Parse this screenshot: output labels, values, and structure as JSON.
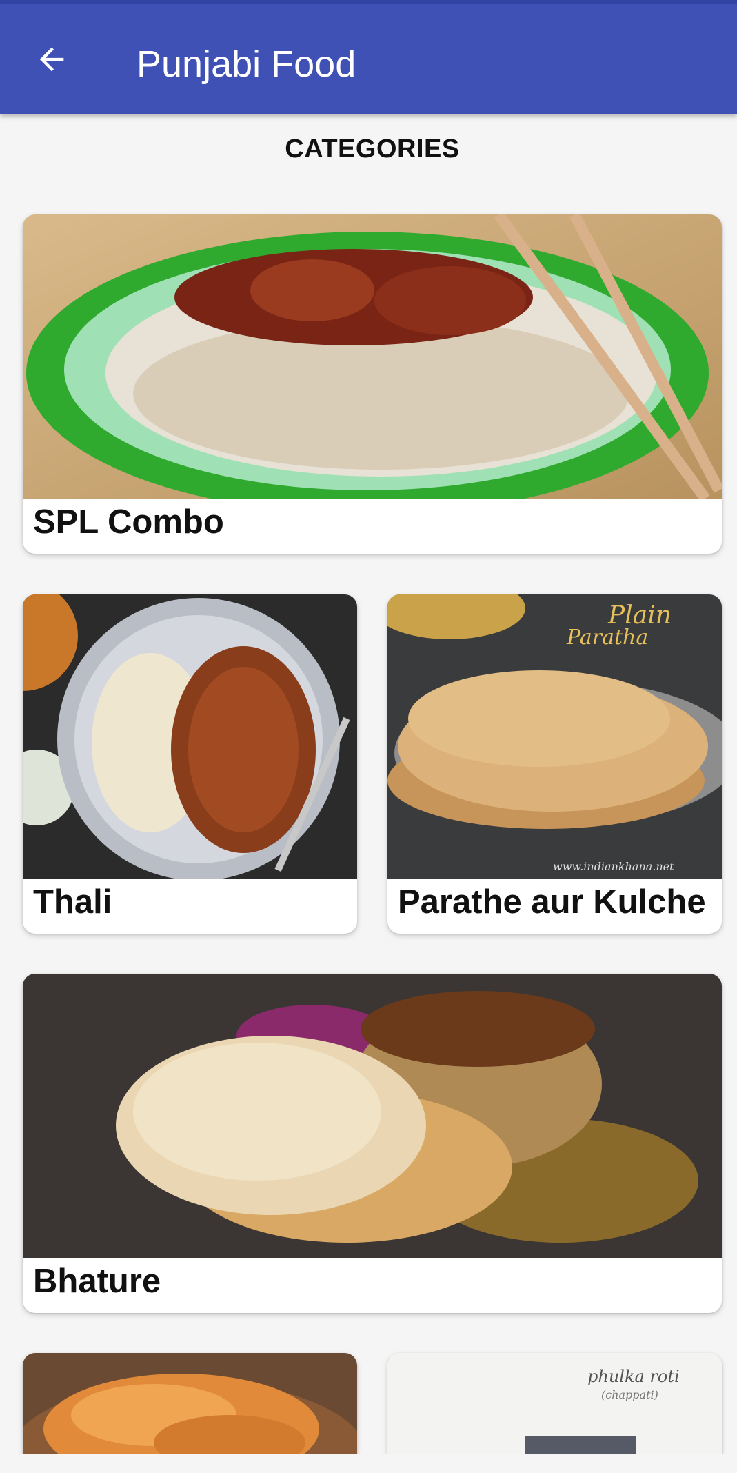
{
  "app_bar": {
    "title": "Punjabi Food",
    "back_icon": "arrow-left-icon",
    "color": "#3f51b5"
  },
  "heading": "CATEGORIES",
  "categories": [
    {
      "label": "SPL Combo",
      "image": "plate-of-fried-rice-with-manchurian-and-chopsticks"
    },
    {
      "label": "Thali",
      "image": "bowl-of-rajma-chawal"
    },
    {
      "label": "Parathe aur Kulche",
      "image": "stack-of-plain-paratha",
      "photo_caption_line1": "Plain",
      "photo_caption_line2": "Paratha",
      "photo_watermark": "www.indiankhana.net"
    },
    {
      "label": "Bhature",
      "image": "chole-bhature-with-brass-pot"
    },
    {
      "label": "",
      "image": "fried-snack-platter"
    },
    {
      "label": "",
      "image": "phulka-roti",
      "photo_caption_line1": "phulka roti",
      "photo_caption_line2": "(chappati)"
    }
  ]
}
